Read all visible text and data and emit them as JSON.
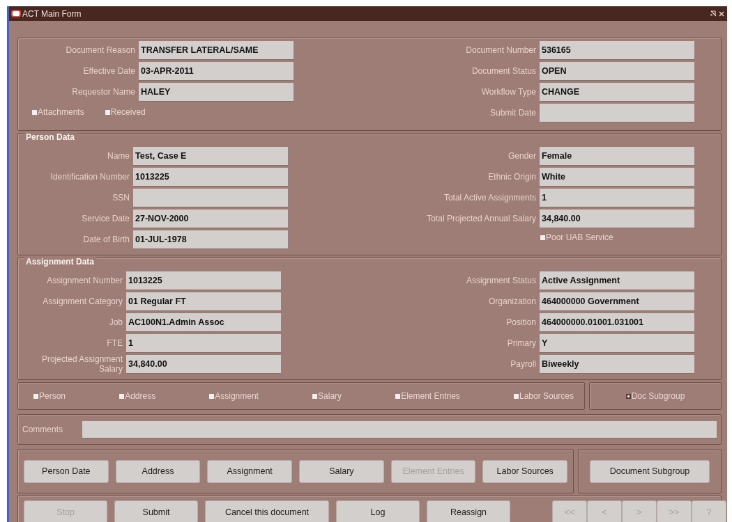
{
  "window": {
    "title": "ACT Main Form"
  },
  "header": {
    "left": [
      {
        "label": "Document Reason",
        "value": "TRANSFER LATERAL/SAME"
      },
      {
        "label": "Effective Date",
        "value": "03-APR-2011"
      },
      {
        "label": "Requestor Name",
        "value": "HALEY"
      }
    ],
    "checkboxes": [
      {
        "label": "Attachments",
        "checked": false
      },
      {
        "label": "Received",
        "checked": false
      }
    ],
    "right": [
      {
        "label": "Document Number",
        "value": "536165"
      },
      {
        "label": "Document Status",
        "value": "OPEN"
      },
      {
        "label": "Workflow Type",
        "value": "CHANGE"
      },
      {
        "label": "Submit Date"
      }
    ]
  },
  "person_data": {
    "title": "Person Data",
    "left": [
      {
        "label": "Name",
        "value": "Test, Case E"
      },
      {
        "label": "Identification Number",
        "value": "1013225"
      },
      {
        "label": "SSN"
      },
      {
        "label": "Service Date",
        "value": "27-NOV-2000"
      },
      {
        "label": "Date of Birth",
        "value": "01-JUL-1978"
      }
    ],
    "right": [
      {
        "label": "Gender",
        "value": "Female"
      },
      {
        "label": "Ethnic Origin",
        "value": "White"
      },
      {
        "label": "Total Active Assignments",
        "value": "1"
      },
      {
        "label": "Total Projected Annual Salary",
        "value": "34,840.00"
      }
    ],
    "checkboxes": [
      {
        "label": "Poor UAB Service",
        "checked": false
      }
    ]
  },
  "assignment_data": {
    "title": "Assignment Data",
    "left": [
      {
        "label": "Assignment Number",
        "value": "1013225"
      },
      {
        "label": "Assignment Category",
        "value": "01 Regular FT"
      },
      {
        "label": "Job",
        "value": "AC100N1.Admin Assoc"
      },
      {
        "label": "FTE",
        "value": "1"
      },
      {
        "label": "Projected Assignment Salary",
        "value": "34,840.00"
      }
    ],
    "right": [
      {
        "label": "Assignment Status",
        "value": "Active Assignment"
      },
      {
        "label": "Organization",
        "value": "464000000 Government"
      },
      {
        "label": "Position",
        "value": "464000000.01001.031001"
      },
      {
        "label": "Primary",
        "value": "Y"
      },
      {
        "label": "Payroll",
        "value": "Biweekly"
      }
    ]
  },
  "tab_checkboxes": [
    {
      "label": "Person",
      "checked": false
    },
    {
      "label": "Address",
      "checked": false
    },
    {
      "label": "Assignment",
      "checked": false
    },
    {
      "label": "Salary",
      "checked": false
    },
    {
      "label": "Element Entries",
      "checked": false
    },
    {
      "label": "Labor Sources",
      "checked": false
    }
  ],
  "subgroup_checkbox": {
    "label": "Doc Subgroup",
    "checked": true
  },
  "comments": {
    "label": "Comments"
  },
  "section_buttons": [
    {
      "label": "Person Date",
      "disabled": false
    },
    {
      "label": "Address",
      "disabled": false
    },
    {
      "label": "Assignment",
      "disabled": false
    },
    {
      "label": "Salary",
      "disabled": false
    },
    {
      "label": "Element Entries",
      "disabled": true
    },
    {
      "label": "Labor Sources",
      "disabled": false
    }
  ],
  "subgroup_button": {
    "label": "Document Subgroup",
    "disabled": false
  },
  "action_buttons": [
    {
      "label": "Stop",
      "disabled": true
    },
    {
      "label": "Submit",
      "disabled": false
    },
    {
      "label": "Cancel this document",
      "disabled": false
    },
    {
      "label": "Log",
      "disabled": false
    },
    {
      "label": "Reassign",
      "disabled": false
    }
  ],
  "nav_buttons": [
    {
      "label": "<<",
      "disabled": true
    },
    {
      "label": "<",
      "disabled": true
    },
    {
      "label": ">",
      "disabled": true
    },
    {
      "label": ">>",
      "disabled": true
    },
    {
      "label": "?",
      "disabled": true
    }
  ]
}
